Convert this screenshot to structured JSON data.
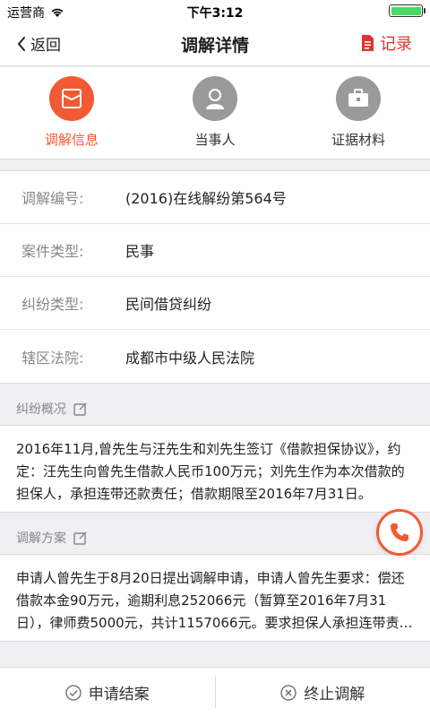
{
  "status_bar": {
    "carrier": "运营商",
    "time": "下午3:12",
    "battery_color": "#4cd964"
  },
  "nav": {
    "back_label": "返回",
    "title": "调解详情",
    "record_label": "记录",
    "record_icon": "document-icon",
    "accent_color": "#e0332f"
  },
  "tabs": [
    {
      "label": "调解信息",
      "icon": "envelope-icon",
      "active": true
    },
    {
      "label": "当事人",
      "icon": "person-icon",
      "active": false
    },
    {
      "label": "证据材料",
      "icon": "briefcase-icon",
      "active": false
    }
  ],
  "info": [
    {
      "label": "调解编号:",
      "value": "(2016)在线解纷第564号"
    },
    {
      "label": "案件类型:",
      "value": "民事"
    },
    {
      "label": "纠纷类型:",
      "value": "民间借贷纠纷"
    },
    {
      "label": "辖区法院:",
      "value": "成都市中级人民法院"
    }
  ],
  "dispute_summary": {
    "title": "纠纷概况",
    "text": "2016年11月,曾先生与汪先生和刘先生签订《借款担保协议》，约定：汪先生向曾先生借款人民币100万元；刘先生作为本次借款的担保人，承担连带还款责任；借款期限至2016年7月31日。"
  },
  "mediation_plan": {
    "title": "调解方案",
    "text": "申请人曾先生于8月20日提出调解申请，申请人曾先生要求：偿还借款本金90万元，逾期利息252066元（暂算至2016年7月31日），律师费5000元，共计1157066元。要求担保人承担连带责任。"
  },
  "bottom": {
    "apply_close_label": "申请结案",
    "terminate_label": "终止调解"
  },
  "brand_color": "#f25a33"
}
